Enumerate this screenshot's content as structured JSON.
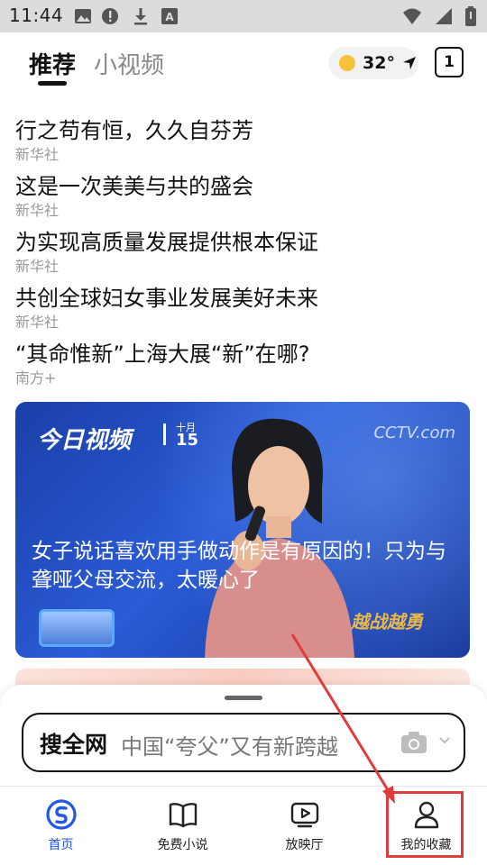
{
  "status_bar": {
    "time": "11:44",
    "left_icons": [
      "image-icon",
      "alert-icon",
      "download-icon",
      "text-icon"
    ],
    "right_icons": [
      "wifi-icon",
      "cell-signal-icon",
      "battery-icon"
    ]
  },
  "header": {
    "tabs": [
      {
        "label": "推荐",
        "active": true
      },
      {
        "label": "小视频",
        "active": false
      }
    ],
    "weather": {
      "temperature": "32°",
      "icon": "sun-icon"
    },
    "tab_count": "1"
  },
  "news": [
    {
      "title": "行之苟有恒，久久自芬芳",
      "source": "新华社"
    },
    {
      "title": "这是一次美美与共的盛会",
      "source": "新华社"
    },
    {
      "title": "为实现高质量发展提供根本保证",
      "source": "新华社"
    },
    {
      "title": "共创全球妇女事业发展美好未来",
      "source": "新华社"
    },
    {
      "title": "“其命惟新”上海大展“新”在哪?",
      "source": "南方+"
    }
  ],
  "feature": {
    "program": "今日视频",
    "month": "十月",
    "day": "15",
    "channel": "CCTV.com",
    "headline": "女子说话喜欢用手做动作是有原因的！只为与聋哑父母交流，太暖心了",
    "stage_logo": "越战越勇"
  },
  "search": {
    "brand": "搜全网",
    "placeholder": "中国“夸父”又有新跨越"
  },
  "bottom_nav": [
    {
      "label": "首页",
      "icon": "home-logo-icon",
      "active": true
    },
    {
      "label": "免费小说",
      "icon": "book-icon",
      "active": false
    },
    {
      "label": "放映厅",
      "icon": "play-screen-icon",
      "active": false
    },
    {
      "label": "我的收藏",
      "icon": "user-icon",
      "active": false
    }
  ],
  "colors": {
    "accent": "#2256e8",
    "annotation": "#e23b3b",
    "card_blue": "#2b5bd6"
  }
}
